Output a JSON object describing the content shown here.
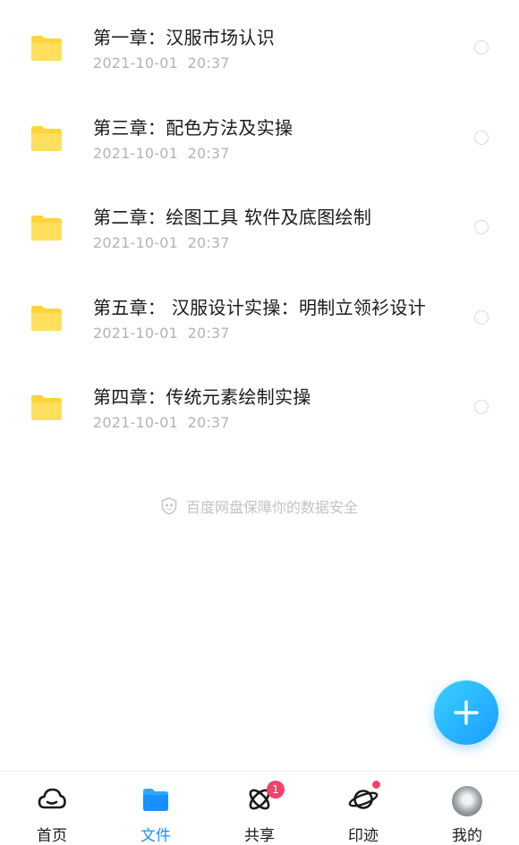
{
  "files": [
    {
      "name": "第一章：汉服市场认识",
      "date": "2021-10-01",
      "time": "20:37"
    },
    {
      "name": "第三章：配色方法及实操",
      "date": "2021-10-01",
      "time": "20:37"
    },
    {
      "name": "第二章：绘图工具 软件及底图绘制",
      "date": "2021-10-01",
      "time": "20:37"
    },
    {
      "name": "第五章： 汉服设计实操：明制立领衫设计",
      "date": "2021-10-01",
      "time": "20:37"
    },
    {
      "name": "第四章：传统元素绘制实操",
      "date": "2021-10-01",
      "time": "20:37"
    }
  ],
  "security_note": "百度网盘保障你的数据安全",
  "tabs": [
    {
      "label": "首页",
      "icon": "cloud-icon"
    },
    {
      "label": "文件",
      "icon": "folder-icon",
      "active": true
    },
    {
      "label": "共享",
      "icon": "share-atom-icon",
      "badge": "1"
    },
    {
      "label": "印迹",
      "icon": "planet-icon",
      "dot": true
    },
    {
      "label": "我的",
      "icon": "avatar"
    }
  ],
  "colors": {
    "accent": "#1a8fff",
    "folder": "#ffd43b",
    "badge": "#f2436a"
  }
}
